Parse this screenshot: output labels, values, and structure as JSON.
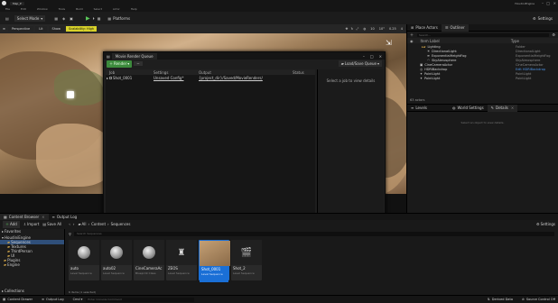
{
  "window": {
    "level_tab": "Map_P",
    "app_title": "HoudiniEngine",
    "menu": [
      "File",
      "Edit",
      "Window",
      "Tools",
      "Build",
      "Select",
      "Actor",
      "Help"
    ]
  },
  "toolbar": {
    "select_mode": "Select Mode",
    "platforms": "Platforms",
    "settings": "Settings"
  },
  "viewport_bar": {
    "perspective": "Perspective",
    "lit": "Lit",
    "show": "Show",
    "scalability": "Scalability: High",
    "grid": "10",
    "angle": "10°",
    "scale": "0.25",
    "camera_speed": "4"
  },
  "outliner": {
    "tabs": [
      "Place Actors",
      "Outliner"
    ],
    "search_placeholder": "Search...",
    "header_label": "Item Label",
    "header_type": "Type",
    "rows": [
      {
        "label": "Lighting",
        "type": "Folder"
      },
      {
        "label": "DirectionalLight",
        "type": "DirectionalLight"
      },
      {
        "label": "ExponentialHeightFog",
        "type": "ExponentialHeightFog"
      },
      {
        "label": "SkyAtmosphere",
        "type": "SkyAtmosphere"
      },
      {
        "label": "CineCameraActor",
        "type": "CineCameraActor"
      },
      {
        "label": "HDRIBackdrop",
        "type": "Edit HDRIBackdrop"
      },
      {
        "label": "PointLight",
        "type": "PointLight"
      },
      {
        "label": "PointLight",
        "type": "PointLight"
      }
    ],
    "count": "63 actors"
  },
  "details_bar": {
    "tabs": [
      "Levels",
      "World Settings",
      "Details"
    ],
    "empty": "Select an object to view details."
  },
  "mrq": {
    "title": "Movie Render Queue",
    "render_button": "Render",
    "load_save": "Load/Save Queue",
    "columns": [
      "Job",
      "Settings",
      "Output",
      "Status"
    ],
    "job": {
      "name": "Shot_0001",
      "settings": "Unsaved Config*",
      "output": "{project_dir}/Saved/MovieRenders/",
      "status": ""
    },
    "right_hint": "Select a job to view details",
    "render_local": "Render (Local)",
    "render_remote": "Render (Remote)"
  },
  "content_browser": {
    "tabs": [
      "Content Browser",
      "Output Log"
    ],
    "add": "Add",
    "import": "Import",
    "save_all": "Save All",
    "breadcrumb": [
      "All",
      "Content",
      "Sequences"
    ],
    "settings": "Settings",
    "favorites": "Favorites",
    "project": "HoudiniEngine",
    "tree": [
      "Sequences",
      "Textures",
      "ThirdPerson",
      "UI",
      "Plugins",
      "Engine"
    ],
    "collections": "Collections",
    "search_placeholder": "Search Sequences",
    "assets": [
      {
        "name": "auto",
        "type": "Level Sequence"
      },
      {
        "name": "auto02",
        "type": "Level Sequence"
      },
      {
        "name": "CineCameraAc",
        "type": "Blueprint Class"
      },
      {
        "name": "ZEOS",
        "type": "Level Sequence"
      },
      {
        "name": "Shot_0001",
        "type": "Level Sequence",
        "selected": true
      },
      {
        "name": "Shot_2",
        "type": "Level Sequence"
      }
    ],
    "status": "6 items (1 selected)"
  },
  "statusbar": {
    "content_drawer": "Content Drawer",
    "output_log": "Output Log",
    "cmd": "Cmd",
    "cmd_placeholder": "Enter Console Command",
    "derived_data": "Derived Data",
    "source_control": "Source Control Off"
  },
  "colors": {
    "accent_blue": "#1a6fd6",
    "green": "#3c8a3c",
    "panel": "#1a1a1a"
  }
}
